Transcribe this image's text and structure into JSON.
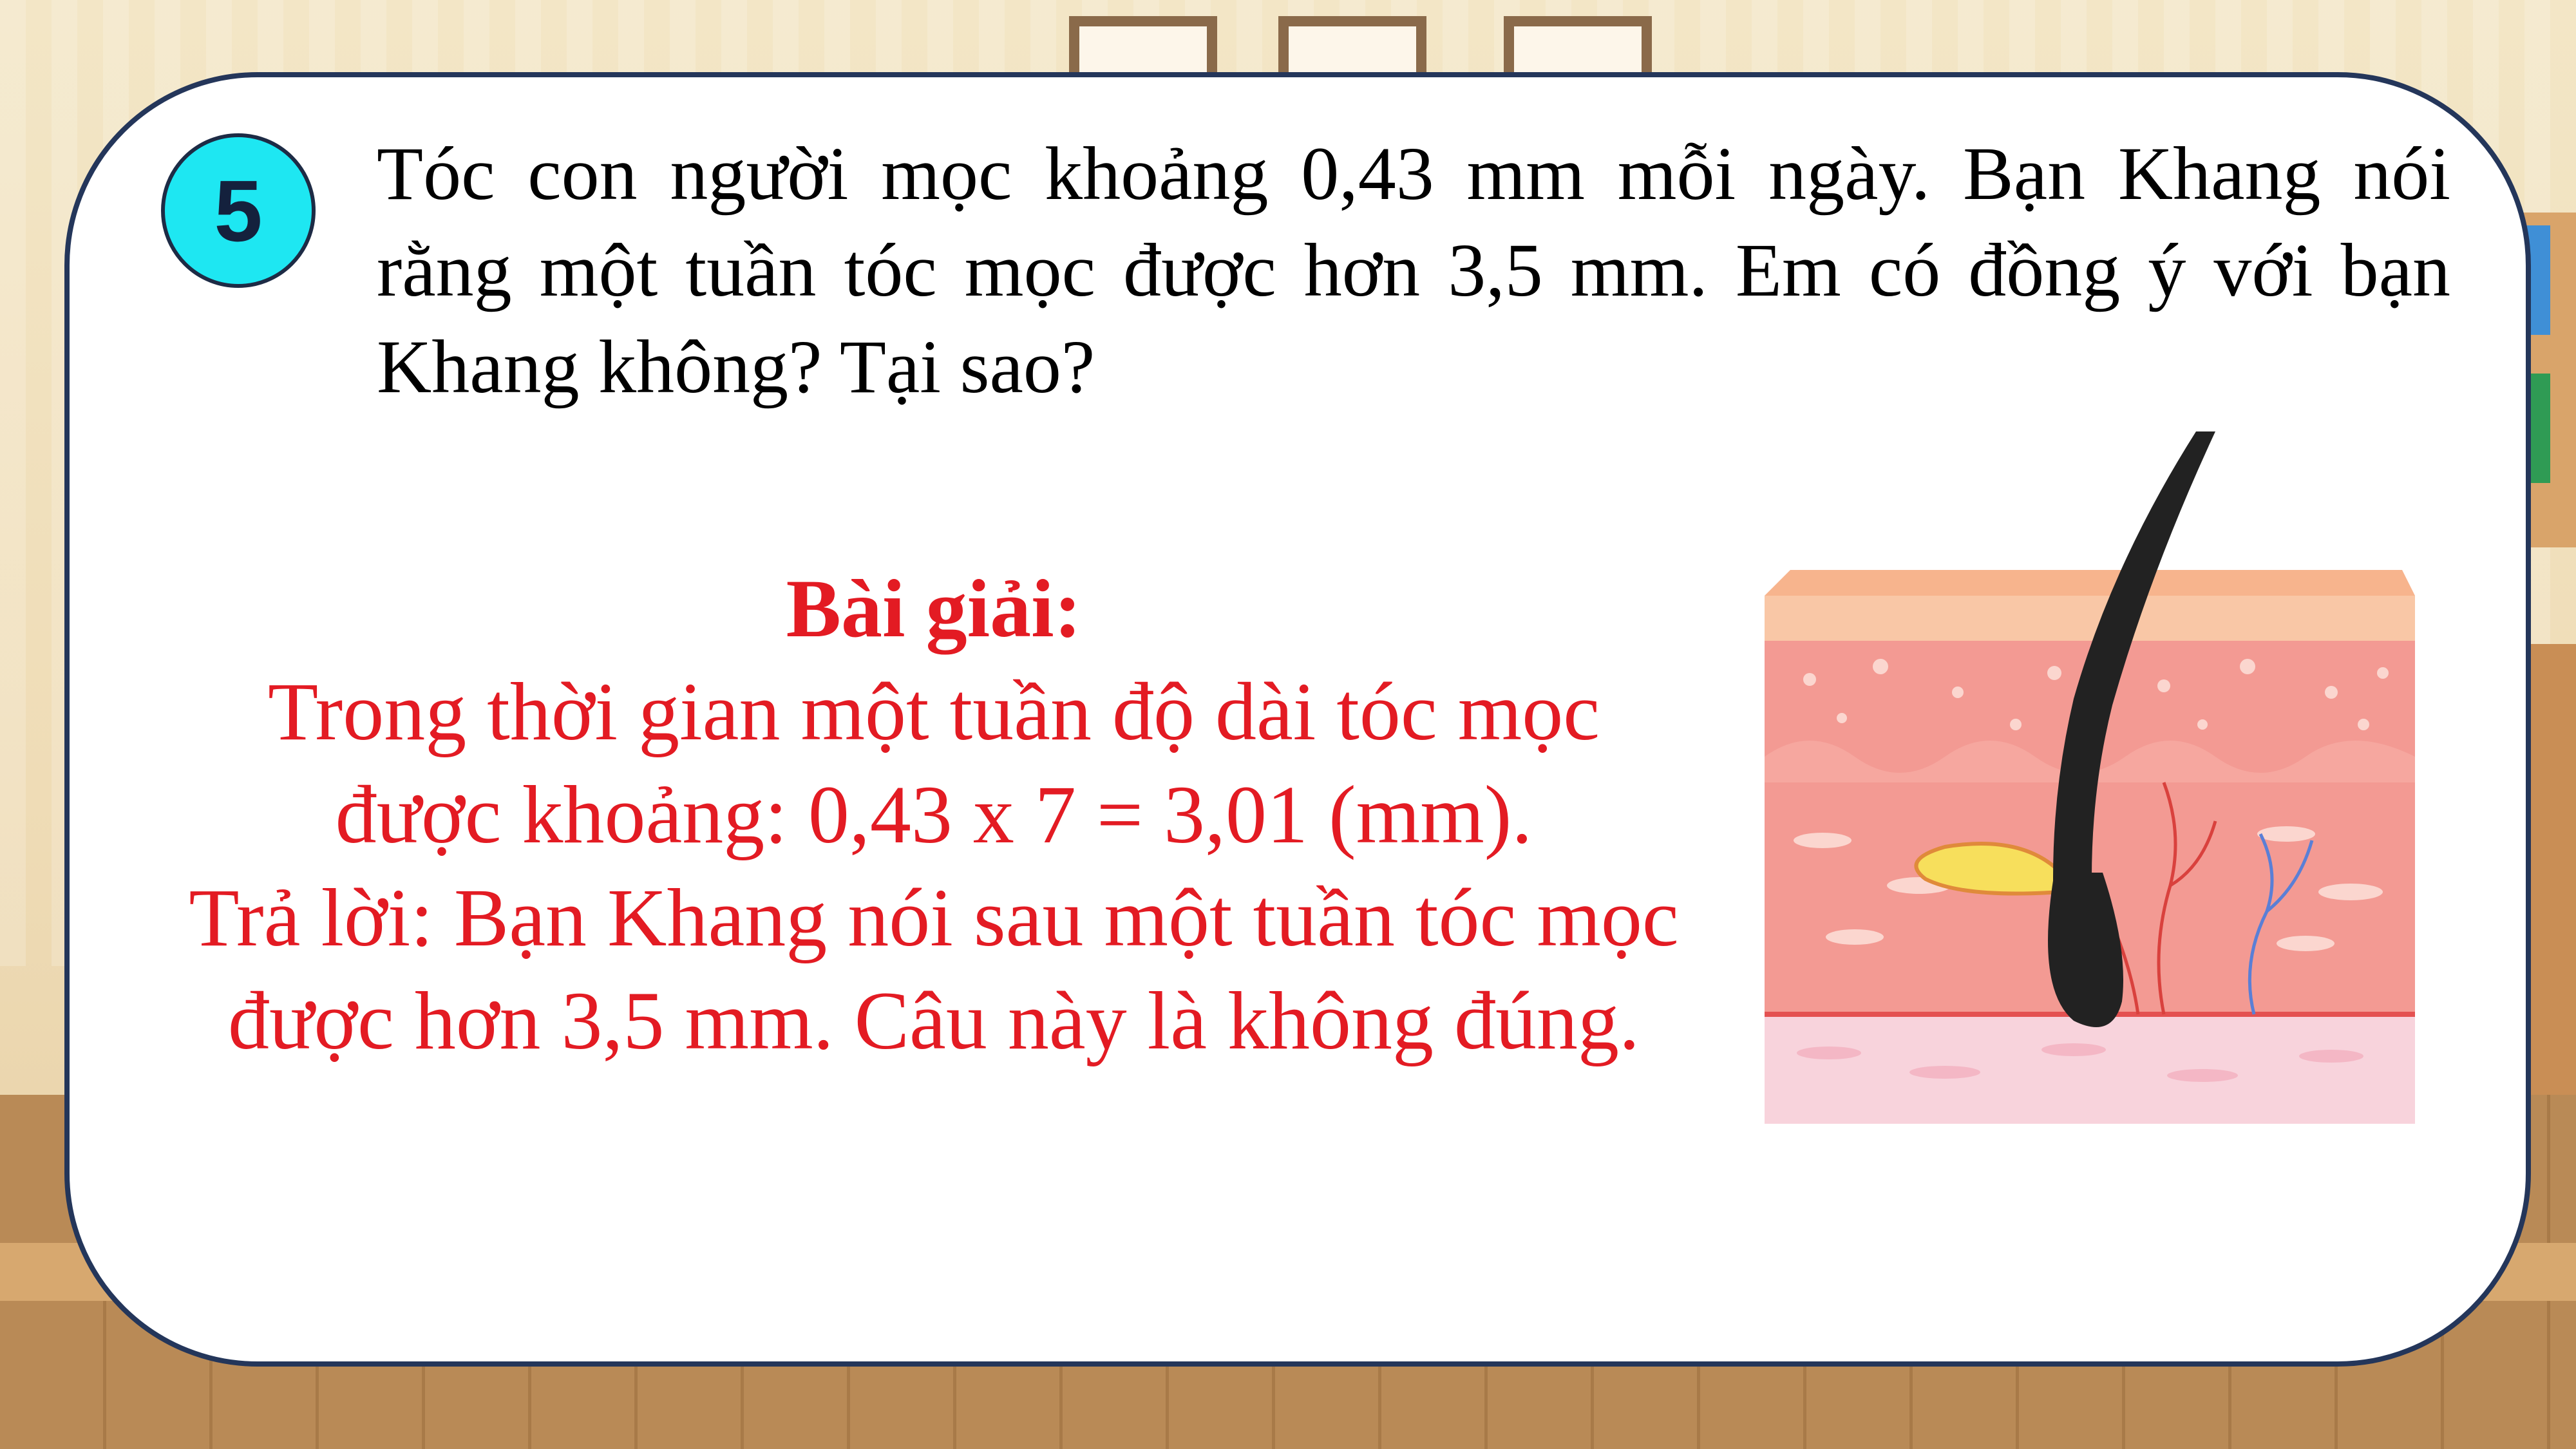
{
  "problem": {
    "number": "5",
    "question": "Tóc con người mọc khoảng 0,43 mm mỗi ngày. Bạn Khang nói rằng một tuần tóc mọc được hơn 3,5 mm. Em có đồng ý với bạn Khang không? Tại sao?"
  },
  "solution": {
    "title": "Bài giải:",
    "lines": [
      "Trong thời gian một tuần độ dài tóc mọc",
      "được khoảng: 0,43 x 7 = 3,01 (mm).",
      "Trả lời: Bạn Khang nói sau một tuần tóc mọc",
      "được hơn 3,5 mm. Câu này là không đúng."
    ]
  },
  "colors": {
    "answer_text": "#e31b23",
    "badge_fill": "#1ee7f2",
    "card_border": "#24365a"
  },
  "illustration": {
    "icon": "hair-follicle-skin-cross-section-icon"
  }
}
